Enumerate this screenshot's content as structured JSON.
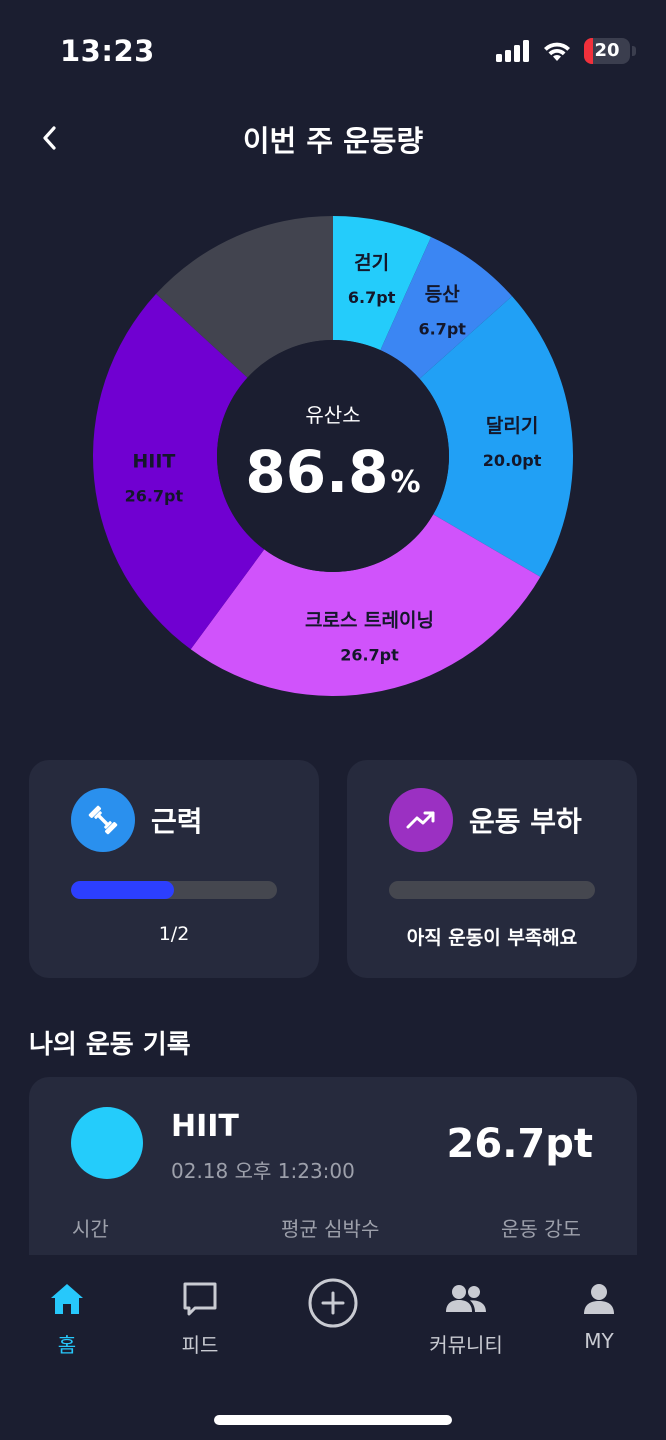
{
  "status_bar": {
    "time": "13:23",
    "battery_level": "20",
    "battery_fraction": 0.2,
    "icons": [
      "cellular-signal-icon",
      "wifi-icon",
      "battery-icon"
    ]
  },
  "header": {
    "back_icon": "chevron-left-icon",
    "title": "이번 주 운동량"
  },
  "donut": {
    "center_title": "유산소",
    "center_value": "86.8",
    "center_unit": "%",
    "segments": [
      {
        "name": "걷기",
        "value_label": "6.7pt",
        "value": 6.7,
        "color": "#24ccfb"
      },
      {
        "name": "등산",
        "value_label": "6.7pt",
        "value": 6.7,
        "color": "#3b86f3"
      },
      {
        "name": "달리기",
        "value_label": "20.0pt",
        "value": 20.0,
        "color": "#21a0f5"
      },
      {
        "name": "크로스 트레이닝",
        "value_label": "26.7pt",
        "value": 26.7,
        "color": "#d053fb"
      },
      {
        "name": "HIIT",
        "value_label": "26.7pt",
        "value": 26.7,
        "color": "#7000d1"
      },
      {
        "name": "",
        "value_label": "",
        "value": 13.2,
        "color": "#42444f"
      }
    ]
  },
  "cards": {
    "strength": {
      "title": "근력",
      "icon": "dumbbell-icon",
      "icon_color": "#2a90ee",
      "progress_text": "1/2",
      "progress": 0.5
    },
    "load": {
      "title": "운동 부하",
      "icon": "trending-up-icon",
      "icon_color": "#9b30c2",
      "progress_text": "아직 운동이 부족해요",
      "progress": 0
    }
  },
  "records": {
    "section_title": "나의 운동 기록",
    "item": {
      "name": "HIIT",
      "date": "02.18 오후 1:23:00",
      "points": "26.7pt",
      "stat_labels": [
        "시간",
        "평균 심박수",
        "운동 강도"
      ]
    }
  },
  "tab_bar": {
    "tabs": [
      {
        "label": "홈",
        "icon": "home-icon",
        "active": true
      },
      {
        "label": "피드",
        "icon": "chat-bubble-icon",
        "active": false
      },
      {
        "label": "",
        "icon": "plus-circle-icon",
        "active": false
      },
      {
        "label": "커뮤니티",
        "icon": "people-icon",
        "active": false
      },
      {
        "label": "MY",
        "icon": "person-icon",
        "active": false
      }
    ]
  },
  "colors": {
    "background": "#1b1e30",
    "card": "#262a3d",
    "accent": "#27c8fb"
  }
}
